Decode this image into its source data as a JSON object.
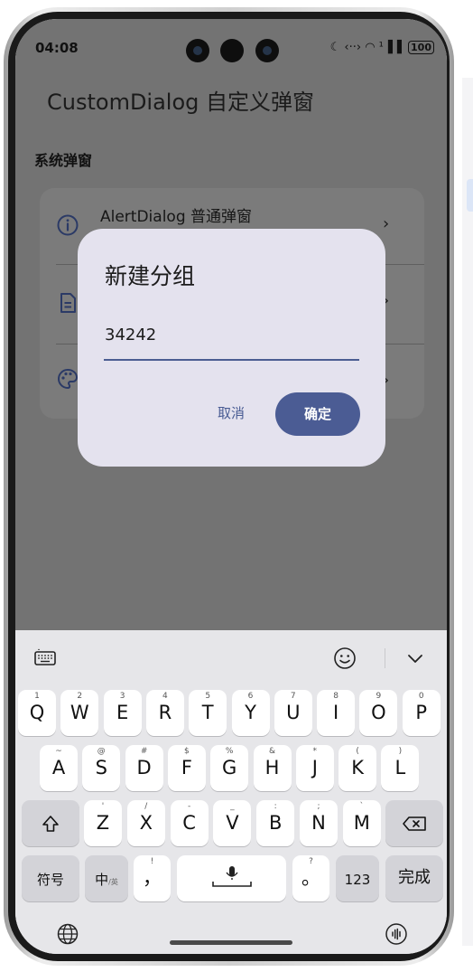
{
  "status_bar": {
    "time": "04:08",
    "icons": [
      "moon-icon",
      "data-transfer-icon",
      "wifi-icon",
      "signal-icon"
    ],
    "icons_text": "☾ ‹··› ◠ ¹▐▐",
    "battery": "100"
  },
  "page": {
    "title": "CustomDialog 自定义弹窗",
    "section_title": "系统弹窗",
    "items": [
      {
        "label": "AlertDialog 普通弹窗",
        "icon": "info-circle-icon"
      },
      {
        "label": "",
        "icon": "document-icon"
      },
      {
        "label": "",
        "icon": "palette-icon"
      }
    ],
    "chevron": "›"
  },
  "dialog": {
    "title": "新建分组",
    "input_value": "34242",
    "cancel_label": "取消",
    "confirm_label": "确定"
  },
  "keyboard": {
    "toolbar_icons": [
      "keyboard-settings-icon",
      "emoji-icon",
      "collapse-keyboard-icon"
    ],
    "row1": [
      {
        "sup": "1",
        "key": "Q"
      },
      {
        "sup": "2",
        "key": "W"
      },
      {
        "sup": "3",
        "key": "E"
      },
      {
        "sup": "4",
        "key": "R"
      },
      {
        "sup": "5",
        "key": "T"
      },
      {
        "sup": "6",
        "key": "Y"
      },
      {
        "sup": "7",
        "key": "U"
      },
      {
        "sup": "8",
        "key": "I"
      },
      {
        "sup": "9",
        "key": "O"
      },
      {
        "sup": "0",
        "key": "P"
      }
    ],
    "row2": [
      {
        "sup": "~",
        "key": "A"
      },
      {
        "sup": "@",
        "key": "S"
      },
      {
        "sup": "#",
        "key": "D"
      },
      {
        "sup": "$",
        "key": "F"
      },
      {
        "sup": "%",
        "key": "G"
      },
      {
        "sup": "&",
        "key": "H"
      },
      {
        "sup": "*",
        "key": "J"
      },
      {
        "sup": "(",
        "key": "K"
      },
      {
        "sup": ")",
        "key": "L"
      }
    ],
    "row3": [
      {
        "sup": "'",
        "key": "Z"
      },
      {
        "sup": "/",
        "key": "X"
      },
      {
        "sup": "-",
        "key": "C"
      },
      {
        "sup": "_",
        "key": "V"
      },
      {
        "sup": ":",
        "key": "B"
      },
      {
        "sup": ";",
        "key": "N"
      },
      {
        "sup": "`",
        "key": "M"
      }
    ],
    "symbols_label": "符号",
    "lang_main": "中",
    "lang_sub": "/英",
    "comma": "，",
    "comma_sup": "!",
    "period": "。",
    "period_sup": "?",
    "numbers_label": "123",
    "done_label": "完成",
    "bottom_icons": [
      "globe-icon",
      "voice-input-icon"
    ]
  }
}
